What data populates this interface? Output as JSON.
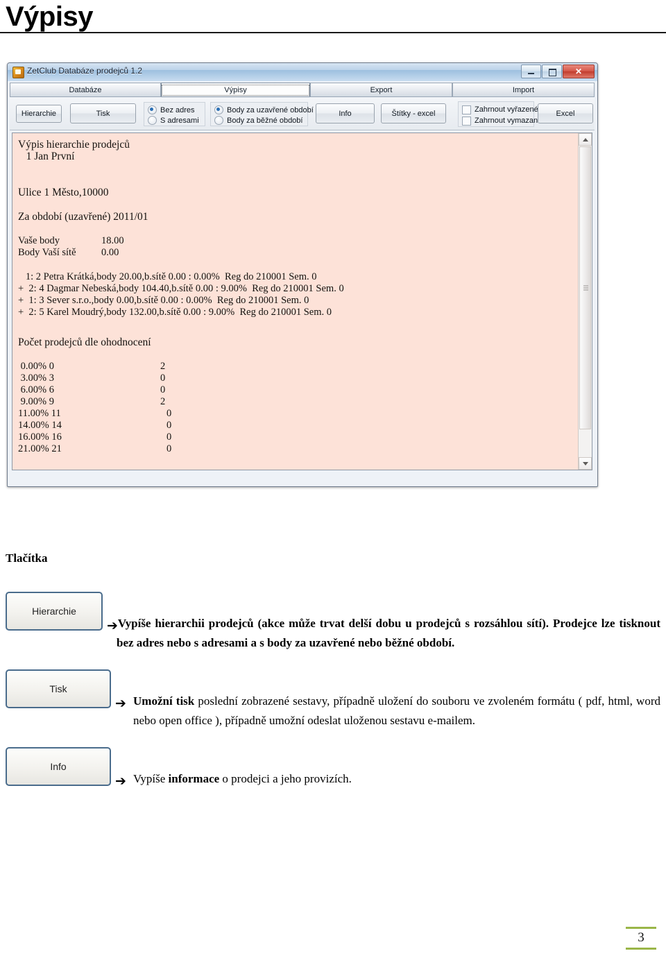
{
  "page": {
    "heading": "Výpisy",
    "number": "3"
  },
  "app_window": {
    "title": "ZetClub Databáze prodejců 1.2",
    "icon": "app-icon",
    "window_buttons": {
      "minimize": "–",
      "maximize": "□",
      "close": "✕"
    },
    "tabs": [
      {
        "label": "Databáze",
        "active": false
      },
      {
        "label": "Výpisy",
        "active": true
      },
      {
        "label": "Export",
        "active": false
      },
      {
        "label": "Import",
        "active": false
      }
    ],
    "toolbar": {
      "hierarchie_label": "Hierarchie",
      "tisk_label": "Tisk",
      "info_label": "Info",
      "stitky_label": "Štítky - excel",
      "excel_label": "Excel",
      "address_radios": [
        {
          "label": "Bez adres",
          "selected": true
        },
        {
          "label": "S adresami",
          "selected": false
        }
      ],
      "period_radios": [
        {
          "label": "Body za uzavřené období",
          "selected": true
        },
        {
          "label": "Body za běžné období",
          "selected": false
        }
      ],
      "import_checks": [
        {
          "label": "Zahrnout vyřazené",
          "checked": false
        },
        {
          "label": "Zahrnout vymazané",
          "checked": false
        }
      ]
    },
    "report": {
      "title": "Výpis hierarchie prodejců",
      "seller": "   1 Jan První",
      "address": "Ulice 1 Město,10000",
      "period": "Za období (uzavřené) 2011/01",
      "points_own_label": "Vaše body",
      "points_own_value": "18.00",
      "points_net_label": "Body Vaší sítě",
      "points_net_value": "0.00",
      "hierarchy_lines": [
        "   1: 2 Petra Krátká,body 20.00,b.sítě 0.00 : 0.00%  Reg do 210001 Sem. 0",
        "+  2: 4 Dagmar Nebeská,body 104.40,b.sítě 0.00 : 9.00%  Reg do 210001 Sem. 0",
        "+  1: 3 Sever s.r.o.,body 0.00,b.sítě 0.00 : 0.00%  Reg do 210001 Sem. 0",
        "+  2: 5 Karel Moudrý,body 132.00,b.sítě 0.00 : 9.00%  Reg do 210001 Sem. 0"
      ],
      "ratings_title": "Počet prodejců dle ohodnocení",
      "ratings_rows": [
        {
          "bracket": " 0.00% 0",
          "count": "2"
        },
        {
          "bracket": " 3.00% 3",
          "count": "0"
        },
        {
          "bracket": " 6.00% 6",
          "count": "0"
        },
        {
          "bracket": " 9.00% 9",
          "count": "2"
        },
        {
          "bracket": "11.00% 11",
          "count": "0"
        },
        {
          "bracket": "14.00% 14",
          "count": "0"
        },
        {
          "bracket": "16.00% 16",
          "count": "0"
        },
        {
          "bracket": "21.00% 21",
          "count": "0"
        }
      ]
    }
  },
  "document": {
    "section_title": "Tlačítka",
    "entries": [
      {
        "button_label": "Hierarchie",
        "arrow": "➔",
        "text_html": "<b>Vypíše <b>hierarchii</b> prodejců (akce může trvat delší dobu u prodejců s rozsáhlou sítí). Prodejce lze tisknout <b>bez adres</b> nebo <b>s adresami</b> a s body za <b>uzavřené</b> nebo <b>běžné</b> období.</b>"
      },
      {
        "button_label": "Tisk",
        "arrow": "➔",
        "text_html": "<b>Umožní tisk</b> poslední zobrazené sestavy, případně uložení do souboru ve zvoleném formátu ( pdf, html, word nebo open office ), případně umožní odeslat uloženou sestavu e-mailem."
      },
      {
        "button_label": "Info",
        "arrow": "➔",
        "text_html": "Vypíše <b>informace</b> o prodejci a jeho provizích."
      }
    ]
  },
  "colors": {
    "report_background": "#fde2d8",
    "accent_green": "#9ab648",
    "radio_selected": "#2a6fb5",
    "title_text": "#1a2433"
  }
}
